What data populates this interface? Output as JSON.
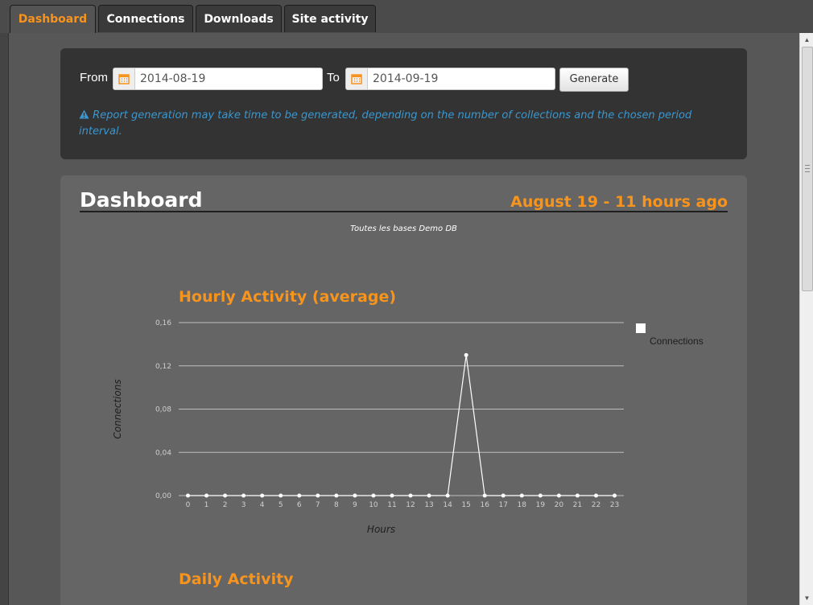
{
  "tabs": [
    {
      "label": "Dashboard",
      "active": true
    },
    {
      "label": "Connections",
      "active": false
    },
    {
      "label": "Downloads",
      "active": false
    },
    {
      "label": "Site activity",
      "active": false
    }
  ],
  "report": {
    "from_label": "From",
    "from_value": "2014-08-19",
    "to_label": "To",
    "to_value": "2014-09-19",
    "generate_label": "Generate",
    "notice_icon": "warning-icon",
    "notice": "Report generation may take time to be generated, depending on the number of collections and the chosen period interval."
  },
  "dashboard": {
    "title": "Dashboard",
    "date": "August 19 - 11 hours ago",
    "subtitle": "Toutes les bases Demo DB"
  },
  "colors": {
    "accent": "#f7941d",
    "notice": "#3a97cf",
    "panel": "#333333",
    "card": "#656565"
  },
  "chart_data": [
    {
      "type": "line",
      "title": "Hourly Activity (average)",
      "xlabel": "Hours",
      "ylabel": "Connections",
      "x": [
        0,
        1,
        2,
        3,
        4,
        5,
        6,
        7,
        8,
        9,
        10,
        11,
        12,
        13,
        14,
        15,
        16,
        17,
        18,
        19,
        20,
        21,
        22,
        23
      ],
      "yticks": [
        "0,00",
        "0,04",
        "0,08",
        "0,12",
        "0,16"
      ],
      "ylim": [
        0,
        0.16
      ],
      "grid": true,
      "legend": "right",
      "series": [
        {
          "name": "Connections",
          "color": "#ffffff",
          "values": [
            0,
            0,
            0,
            0,
            0,
            0,
            0,
            0,
            0,
            0,
            0,
            0,
            0,
            0,
            0,
            0.13,
            0,
            0,
            0,
            0,
            0,
            0,
            0,
            0
          ]
        }
      ]
    },
    {
      "type": "line",
      "title": "Daily Activity"
    }
  ]
}
